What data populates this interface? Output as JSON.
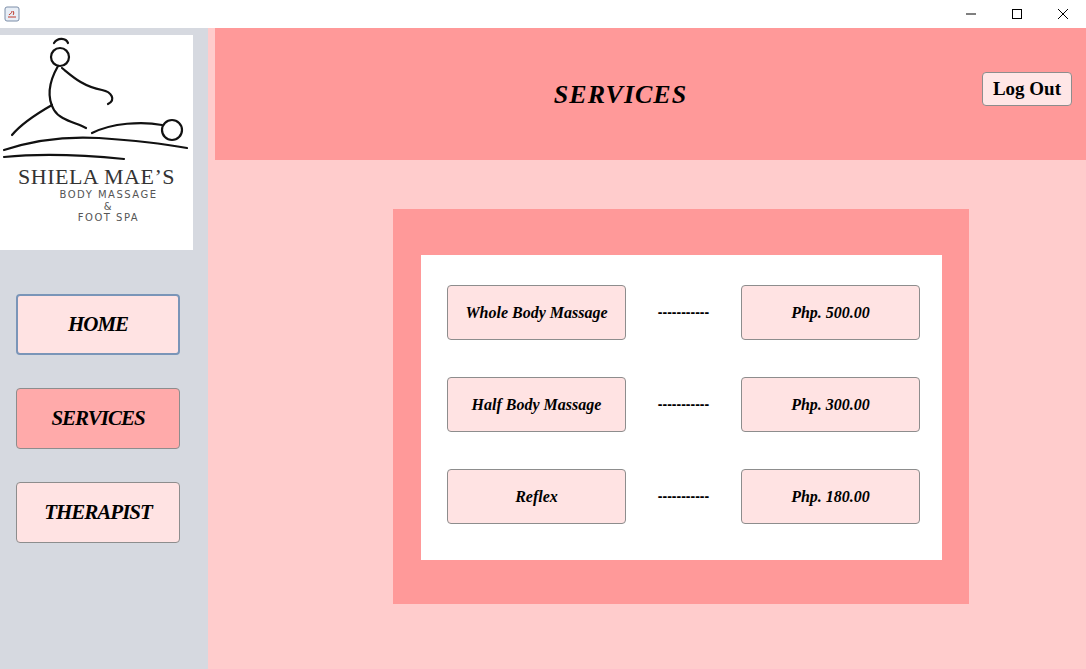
{
  "logo": {
    "name": "SHIELA MAE’S",
    "lines": [
      "BODY MASSAGE",
      "&",
      "FOOT SPA"
    ]
  },
  "sidebar": {
    "items": [
      {
        "label": "HOME",
        "selected": false,
        "focused": true
      },
      {
        "label": "SERVICES",
        "selected": true,
        "focused": false
      },
      {
        "label": "THERAPIST",
        "selected": false,
        "focused": false
      }
    ]
  },
  "header": {
    "title": "SERVICES",
    "logout": "Log Out"
  },
  "services": [
    {
      "name": "Whole Body Massage",
      "separator": "-----------",
      "price": "Php. 500.00"
    },
    {
      "name": "Half Body Massage",
      "separator": "-----------",
      "price": "Php. 300.00"
    },
    {
      "name": "Reflex",
      "separator": "-----------",
      "price": "Php. 180.00"
    }
  ]
}
